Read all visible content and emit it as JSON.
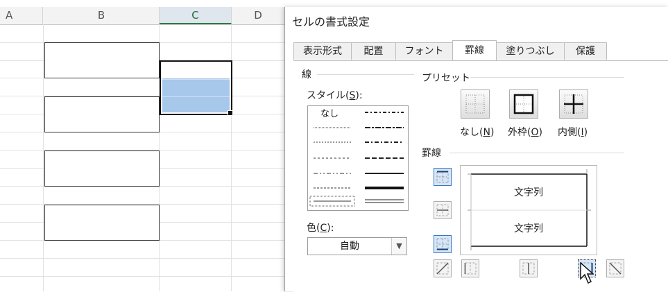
{
  "sheet": {
    "columns": [
      "A",
      "B",
      "C",
      "D"
    ]
  },
  "dialog": {
    "title": "セルの書式設定",
    "tabs": [
      "表示形式",
      "配置",
      "フォント",
      "罫線",
      "塗りつぶし",
      "保護"
    ],
    "active_tab": "罫線",
    "line_group": {
      "title": "線",
      "style_label": "スタイル(",
      "style_accel": "S",
      "style_label_end": "):",
      "none_label": "なし",
      "color_label": "色(",
      "color_accel": "C",
      "color_label_end": "):",
      "color_value": "自動"
    },
    "preset_group": {
      "title": "プリセット",
      "buttons": [
        {
          "label": "なし(",
          "accel": "N",
          "end": ")"
        },
        {
          "label": "外枠(",
          "accel": "O",
          "end": ")"
        },
        {
          "label": "内側(",
          "accel": "I",
          "end": ")"
        }
      ]
    },
    "border_group": {
      "title": "罫線",
      "preview_text_top": "文字列",
      "preview_text_bottom": "文字列"
    }
  },
  "colors": {
    "selection_fill": "#a7c7eb",
    "active_border_button": "#d5e6f8",
    "column_selected_text": "#1d6a34"
  }
}
